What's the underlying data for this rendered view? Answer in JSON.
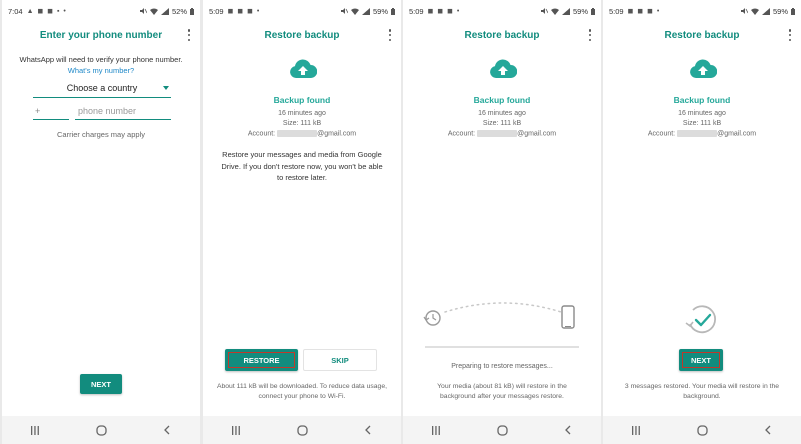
{
  "colors": {
    "accent": "#128c7e",
    "link": "#1e88c8"
  },
  "screens": [
    {
      "status": {
        "time": "7:04",
        "glyphs": "▲ ◼ ◼ ▪ •",
        "battery": "52%"
      },
      "title": "Enter your phone number",
      "verify_text": "WhatsApp will need to verify your phone number.",
      "whats_my_number": "What's my number?",
      "country_select": "Choose a country",
      "country_code_prefix": "+",
      "phone_placeholder": "phone number",
      "carrier_note": "Carrier charges may apply",
      "next_label": "NEXT"
    },
    {
      "status": {
        "time": "5:09",
        "glyphs": "◼ ◼ ◼ •",
        "battery": "59%"
      },
      "title": "Restore backup",
      "backup_found": "Backup found",
      "time_ago": "16 minutes ago",
      "size": "Size: 111 kB",
      "account_label": "Account:",
      "account_domain": "@gmail.com",
      "restore_message": "Restore your messages and media from Google Drive. If you don't restore now, you won't be able to restore later.",
      "restore_label": "RESTORE",
      "skip_label": "SKIP",
      "download_note": "About 111 kB will be downloaded. To reduce data usage, connect your phone to Wi-Fi."
    },
    {
      "status": {
        "time": "5:09",
        "glyphs": "◼ ◼ ◼ •",
        "battery": "59%"
      },
      "title": "Restore backup",
      "backup_found": "Backup found",
      "time_ago": "16 minutes ago",
      "size": "Size: 111 kB",
      "account_label": "Account:",
      "account_domain": "@gmail.com",
      "preparing": "Preparing to restore messages...",
      "media_note": "Your media (about 81 kB) will restore in the background after your messages restore."
    },
    {
      "status": {
        "time": "5:09",
        "glyphs": "◼ ◼ ◼ •",
        "battery": "59%"
      },
      "title": "Restore backup",
      "backup_found": "Backup found",
      "time_ago": "16 minutes ago",
      "size": "Size: 111 kB",
      "account_label": "Account:",
      "account_domain": "@gmail.com",
      "next_label": "NEXT",
      "restored_note": "3 messages restored. Your media will restore in the background."
    }
  ],
  "icons": {
    "status_right": [
      "mute-icon",
      "wifi-icon",
      "signal-icon",
      "battery-icon"
    ],
    "navbar": [
      "recent-apps-icon",
      "home-icon",
      "back-icon"
    ]
  }
}
